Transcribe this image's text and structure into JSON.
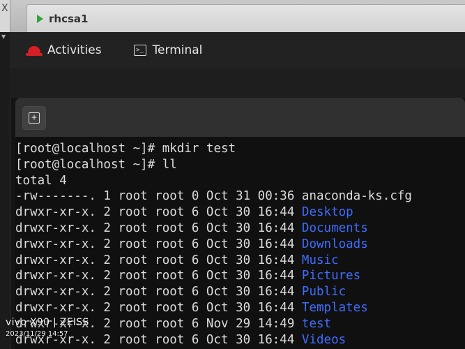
{
  "vm": {
    "close_glyph": "X",
    "tab_title": "rhcsa1"
  },
  "topbar": {
    "activities": "Activities",
    "app_name": "Terminal"
  },
  "terminal": {
    "new_tab_glyph": "+",
    "lines": [
      {
        "text": "[root@localhost ~]# mkdir test"
      },
      {
        "text": "[root@localhost ~]# ll"
      },
      {
        "text": "total 4"
      },
      {
        "meta": "-rw-------. 1 root root 0 Oct 31 00:36",
        "name": "anaconda-ks.cfg",
        "kind": "file"
      },
      {
        "meta": "drwxr-xr-x. 2 root root 6 Oct 30 16:44",
        "name": "Desktop",
        "kind": "dir"
      },
      {
        "meta": "drwxr-xr-x. 2 root root 6 Oct 30 16:44",
        "name": "Documents",
        "kind": "dir"
      },
      {
        "meta": "drwxr-xr-x. 2 root root 6 Oct 30 16:44",
        "name": "Downloads",
        "kind": "dir"
      },
      {
        "meta": "drwxr-xr-x. 2 root root 6 Oct 30 16:44",
        "name": "Music",
        "kind": "dir"
      },
      {
        "meta": "drwxr-xr-x. 2 root root 6 Oct 30 16:44",
        "name": "Pictures",
        "kind": "dir"
      },
      {
        "meta": "drwxr-xr-x. 2 root root 6 Oct 30 16:44",
        "name": "Public",
        "kind": "dir"
      },
      {
        "meta": "drwxr-xr-x. 2 root root 6 Oct 30 16:44",
        "name": "Templates",
        "kind": "dir"
      },
      {
        "meta": "drwxr-xr-x. 2 root root 6 Nov 29 14:49",
        "name": "test",
        "kind": "dir"
      },
      {
        "meta": "drwxr-xr-x. 2 root root 6 Oct 30 16:44",
        "name": "Videos",
        "kind": "dir"
      }
    ]
  },
  "colors": {
    "directory": "#3f6dff",
    "text": "#dcdcdc",
    "redhat": "#d41f26",
    "vm_running": "#2fa33a"
  },
  "watermark": {
    "brand": "vivo X90 | ZEISS",
    "datetime": "2023/11/29 14:57"
  }
}
